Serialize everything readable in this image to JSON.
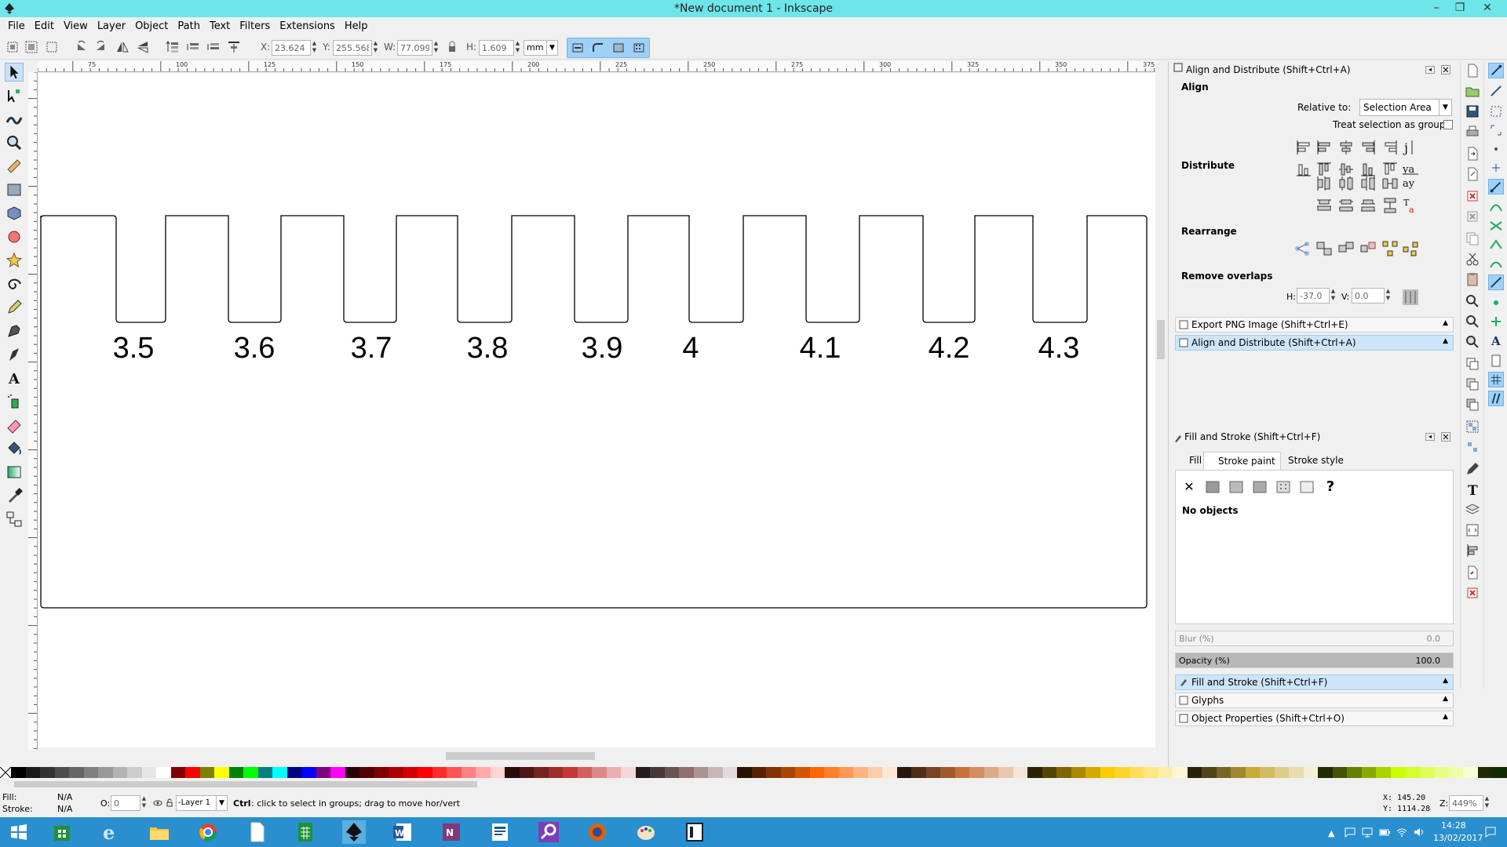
{
  "window": {
    "title": "*New document 1 - Inkscape",
    "minimize": "–",
    "restore": "❐",
    "close": "✕"
  },
  "menu": [
    "File",
    "Edit",
    "View",
    "Layer",
    "Object",
    "Path",
    "Text",
    "Filters",
    "Extensions",
    "Help"
  ],
  "toolbar": {
    "x_label": "X:",
    "x_value": "23.624",
    "y_label": "Y:",
    "y_value": "255.568",
    "w_label": "W:",
    "w_value": "77.099",
    "h_label": "H:",
    "h_value": "1.609",
    "unit": "mm"
  },
  "ruler_top": [
    "75",
    "100",
    "125",
    "150",
    "175",
    "200",
    "225",
    "250",
    "275",
    "300",
    "325",
    "350",
    "375"
  ],
  "canvas": {
    "labels": [
      "3.5",
      "3.6",
      "3.7",
      "3.8",
      "3.9",
      "4",
      "4.1",
      "4.2",
      "4.3"
    ]
  },
  "align_panel": {
    "title": "Align and Distribute (Shift+Ctrl+A)",
    "align_heading": "Align",
    "relative_label": "Relative to:",
    "relative_value": "Selection Area",
    "treat_group_label": "Treat selection as group:",
    "distribute_heading": "Distribute",
    "rearrange_heading": "Rearrange",
    "remove_overlaps_heading": "Remove overlaps",
    "h_label": "H:",
    "h_value": "-37.0",
    "v_label": "V:",
    "v_value": "0.0"
  },
  "collapsed_panels": {
    "export": "Export PNG Image (Shift+Ctrl+E)",
    "align": "Align and Distribute (Shift+Ctrl+A)",
    "fill_stroke": "Fill and Stroke (Shift+Ctrl+F)",
    "glyphs": "Glyphs",
    "object_props": "Object Properties (Shift+Ctrl+O)"
  },
  "fill_panel": {
    "title": "Fill and Stroke (Shift+Ctrl+F)",
    "tabs": [
      "Fill",
      "Stroke paint",
      "Stroke style"
    ],
    "x_symbol": "✕",
    "question": "?",
    "no_objects": "No objects",
    "blur_label": "Blur (%)",
    "blur_value": "0.0",
    "opacity_label": "Opacity (%)",
    "opacity_value": "100.0",
    "opacity_level": 1.0
  },
  "status": {
    "fill_label": "Fill:",
    "fill_value": "N/A",
    "stroke_label": "Stroke:",
    "stroke_value": "N/A",
    "o_label": "O:",
    "o_value": "0",
    "layer": "-Layer 1",
    "message_bold": "Ctrl",
    "message": ": click to select in groups; drag to move hor/vert",
    "x_coord": "X:  145.20",
    "y_coord": "Y: 1114.28",
    "z_label": "Z:",
    "zoom": "449%"
  },
  "tray": {
    "time": "14:28",
    "date": "13/02/2017"
  },
  "palette_colors": [
    "#000000",
    "#1a1a1a",
    "#333333",
    "#4d4d4d",
    "#666666",
    "#808080",
    "#999999",
    "#b3b3b3",
    "#cccccc",
    "#e6e6e6",
    "#ffffff",
    "#800000",
    "#ff0000",
    "#808000",
    "#ffff00",
    "#008000",
    "#00ff00",
    "#008080",
    "#00ffff",
    "#000080",
    "#0000ff",
    "#800080",
    "#ff00ff",
    "#2b0000",
    "#550000",
    "#800000",
    "#aa0000",
    "#d40000",
    "#ff0000",
    "#ff2a2a",
    "#ff5555",
    "#ff8080",
    "#ffaaaa",
    "#ffd5d5",
    "#280b0b",
    "#501616",
    "#782121",
    "#a02c2c",
    "#c83737",
    "#d35f5f",
    "#de8787",
    "#e9afaf",
    "#f4d7d7",
    "#241c1c",
    "#483737",
    "#6c5353",
    "#916f6f",
    "#ac9393",
    "#c8b7b7",
    "#e3dbdb",
    "#2b1100",
    "#552200",
    "#803300",
    "#aa4400",
    "#d45500",
    "#ff6600",
    "#ff7f2a",
    "#ff9955",
    "#ffb380",
    "#ffccaa",
    "#ffe6d5",
    "#28170b",
    "#502d16",
    "#784421",
    "#a05a2c",
    "#c87137",
    "#d38d5f",
    "#deaa87",
    "#e9c6af",
    "#f4e3d7",
    "#2b2200",
    "#554400",
    "#806600",
    "#aa8800",
    "#d4aa00",
    "#ffcc00",
    "#ffd42a",
    "#ffdd55",
    "#ffe680",
    "#ffeeaa",
    "#fff6d5",
    "#28220b",
    "#504416",
    "#786721",
    "#a0892c",
    "#c8ab37",
    "#d3bc5f",
    "#decd87",
    "#e9ddaf",
    "#f4eed7",
    "#222b00",
    "#445500",
    "#668000",
    "#88aa00",
    "#aad400",
    "#ccff00",
    "#d4ff2a",
    "#ddff55",
    "#e5ff80",
    "#eeffaa",
    "#f6ffd5",
    "#1c2b00",
    "#112b00"
  ]
}
